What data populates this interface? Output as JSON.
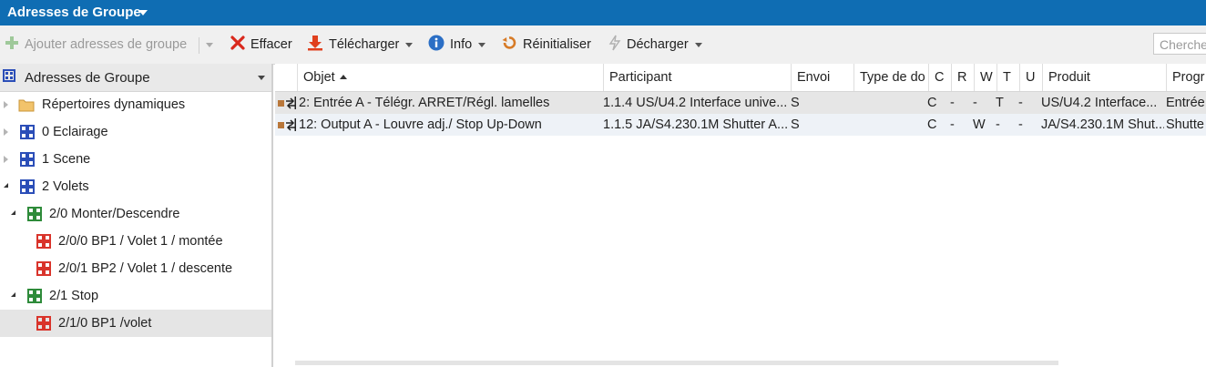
{
  "titlebar": {
    "title": "Adresses de Groupe"
  },
  "toolbar": {
    "add_label": "Ajouter adresses de groupe",
    "delete_label": "Effacer",
    "download_label": "Télécharger",
    "info_label": "Info",
    "reset_label": "Réinitialiser",
    "unload_label": "Décharger",
    "search_placeholder": "Cherche"
  },
  "left_panel": {
    "header": "Adresses de Groupe",
    "items": [
      {
        "label": "Répertoires dynamiques",
        "icon": "folder-icon"
      },
      {
        "label": "0 Eclairage",
        "icon": "main-group-icon"
      },
      {
        "label": "1 Scene",
        "icon": "main-group-icon"
      },
      {
        "label": "2 Volets",
        "icon": "main-group-icon"
      },
      {
        "label": "2/0 Monter/Descendre",
        "icon": "middle-group-icon"
      },
      {
        "label": "2/0/0 BP1 / Volet 1 / montée",
        "icon": "group-address-icon"
      },
      {
        "label": "2/0/1 BP2 / Volet 1 / descente",
        "icon": "group-address-icon"
      },
      {
        "label": "2/1 Stop",
        "icon": "middle-group-icon"
      },
      {
        "label": "2/1/0 BP1 /volet",
        "icon": "group-address-icon"
      }
    ]
  },
  "grid": {
    "columns": [
      "Objet",
      "Participant",
      "Envoi",
      "Type de do",
      "C",
      "R",
      "W",
      "T",
      "U",
      "Produit",
      "Progr"
    ],
    "rows": [
      {
        "objet": "2: Entrée A - Télégr. ARRET/Régl. lamelles",
        "participant": "1.1.4 US/U4.2 Interface unive...",
        "envoi": "S",
        "type": "",
        "c": "C",
        "r": "-",
        "w": "-",
        "t": "T",
        "u": "-",
        "produit": "US/U4.2 Interface...",
        "progr": "Entrée"
      },
      {
        "objet": "12: Output A - Louvre adj./ Stop Up-Down",
        "participant": "1.1.5 JA/S4.230.1M Shutter A...",
        "envoi": "S",
        "type": "",
        "c": "C",
        "r": "-",
        "w": "W",
        "t": "-",
        "u": "-",
        "produit": "JA/S4.230.1M Shut...",
        "progr": "Shutte"
      }
    ]
  },
  "colors": {
    "titlebar": "#0f6db3",
    "delete": "#d9281c",
    "download": "#e0401e",
    "info": "#2c6fc5",
    "reset": "#d77b27"
  }
}
